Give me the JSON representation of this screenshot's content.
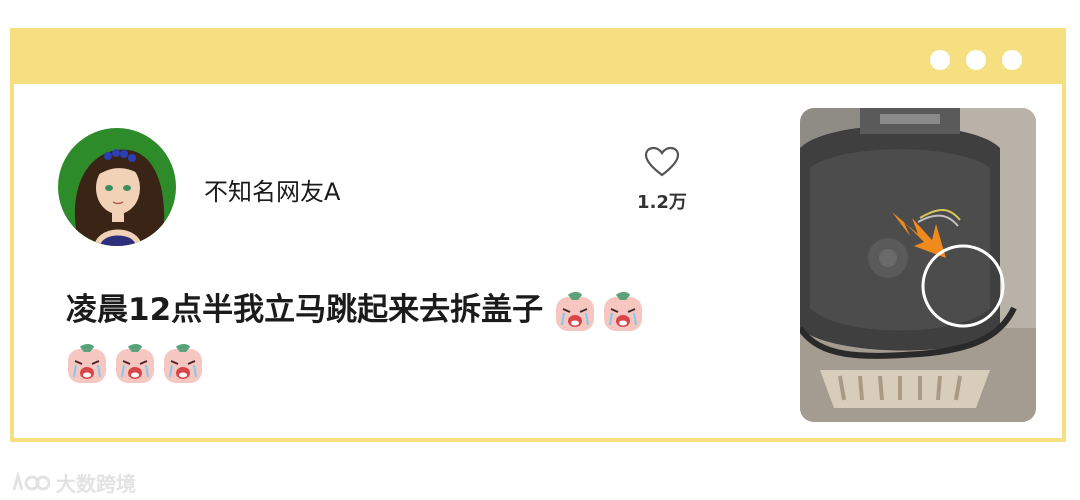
{
  "post": {
    "username": "不知名网友A",
    "text": "凌晨12点半我立马跳起来去拆盖子",
    "likes": "1.2万",
    "emoji_count": 5
  },
  "watermark": {
    "text": "大数跨境"
  },
  "colors": {
    "frame": "#f5df80",
    "background": "#ffffff",
    "text": "#1b1b1b",
    "arrow": "#f08a1c"
  },
  "icons": [
    "heart-icon",
    "crying-emoji-icon",
    "avatar-illustration",
    "rice-cooker-photo"
  ]
}
